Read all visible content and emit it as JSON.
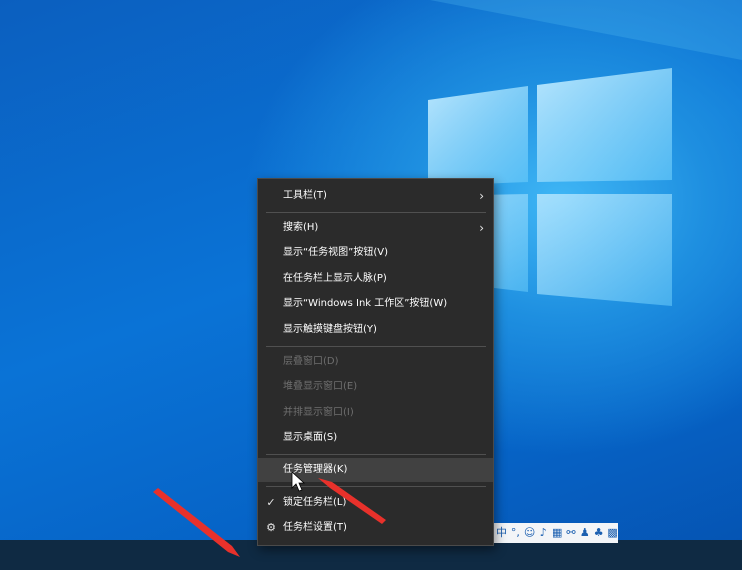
{
  "context_menu": {
    "items": [
      {
        "label": "工具栏(T)"
      },
      {
        "label": "搜索(H)"
      },
      {
        "label": "显示“任务视图”按钮(V)"
      },
      {
        "label": "在任务栏上显示人脉(P)"
      },
      {
        "label": "显示“Windows Ink 工作区”按钮(W)"
      },
      {
        "label": "显示触摸键盘按钮(Y)"
      },
      {
        "label": "层叠窗口(D)"
      },
      {
        "label": "堆叠显示窗口(E)"
      },
      {
        "label": "并排显示窗口(I)"
      },
      {
        "label": "显示桌面(S)"
      },
      {
        "label": "任务管理器(K)"
      },
      {
        "label": "锁定任务栏(L)"
      },
      {
        "label": "任务栏设置(T)"
      }
    ]
  },
  "tray": {
    "ime_mode": "中"
  },
  "colors": {
    "menu_bg": "#2b2b2b",
    "menu_hover": "#414141",
    "arrow_red": "#e8312b",
    "taskbar": "#0f2a43"
  }
}
